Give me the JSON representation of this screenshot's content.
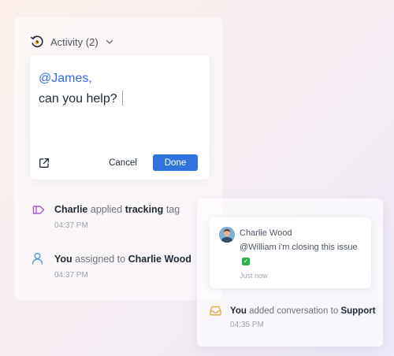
{
  "activity": {
    "title": "Activity (2)"
  },
  "editor": {
    "mention": "@James,",
    "text": "can you help?",
    "cancel_label": "Cancel",
    "done_label": "Done"
  },
  "events": [
    {
      "actor": "Charlie",
      "action": "applied",
      "object": "tracking",
      "suffix": "tag",
      "time": "04:37 PM"
    },
    {
      "actor": "You",
      "action": "assigned to",
      "object": "Charlie Wood",
      "time": "04:37 PM"
    }
  ],
  "comment": {
    "author": "Charlie Wood",
    "mention": "@William",
    "message": "i'm closing this issue",
    "time": "Just now"
  },
  "conversation_event": {
    "actor": "You",
    "action": "added conversation to",
    "object": "Support",
    "time": "04:35 PM"
  },
  "colors": {
    "accent": "#2f73df",
    "mention": "#2f6fd6",
    "tag_icon": "#a55cd6",
    "user_icon": "#4a95d8",
    "inbox_icon": "#e8a23a"
  }
}
